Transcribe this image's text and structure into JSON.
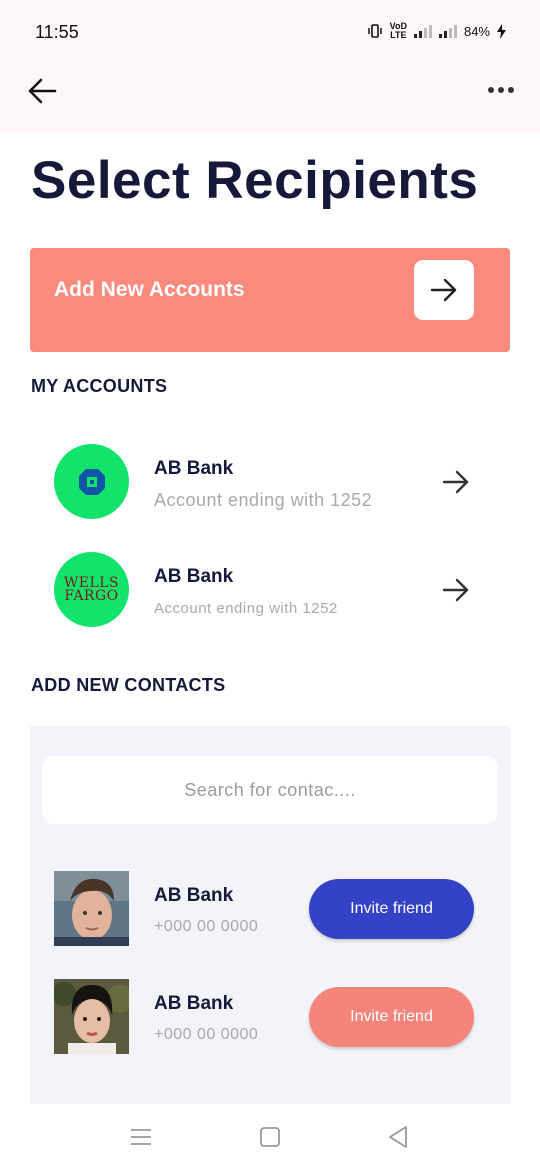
{
  "status_bar": {
    "time": "11:55",
    "volte_line1": "VoD",
    "volte_line2": "LTE",
    "battery": "84%"
  },
  "app_bar": {
    "back_icon": "arrow-left-icon",
    "more_icon": "more-horizontal-icon"
  },
  "page": {
    "title": "Select Recipients"
  },
  "add_banner": {
    "label": "Add New Accounts",
    "color": "#fb8a7d"
  },
  "my_accounts": {
    "heading": "MY ACCOUNTS",
    "items": [
      {
        "name": "AB Bank",
        "subtitle": "Account ending with 1252",
        "logo": "chase-logo"
      },
      {
        "name": "AB Bank",
        "subtitle": "Account ending with 1252",
        "logo": "wells-fargo-logo",
        "logo_text_1": "WELLS",
        "logo_text_2": "FARGO"
      }
    ]
  },
  "new_contacts": {
    "heading": "ADD NEW CONTACTS",
    "search_placeholder": "Search for contac....",
    "items": [
      {
        "name": "AB Bank",
        "phone": "+000 00 0000",
        "button": "Invite friend",
        "button_color": "#3442c6"
      },
      {
        "name": "AB Bank",
        "phone": "+000 00 0000",
        "button": "Invite friend",
        "button_color": "#f5857a"
      }
    ]
  },
  "colors": {
    "accent": "#fb8a7d",
    "primary_blue": "#3442c6",
    "logo_green": "#12e36a",
    "title": "#16193a"
  }
}
